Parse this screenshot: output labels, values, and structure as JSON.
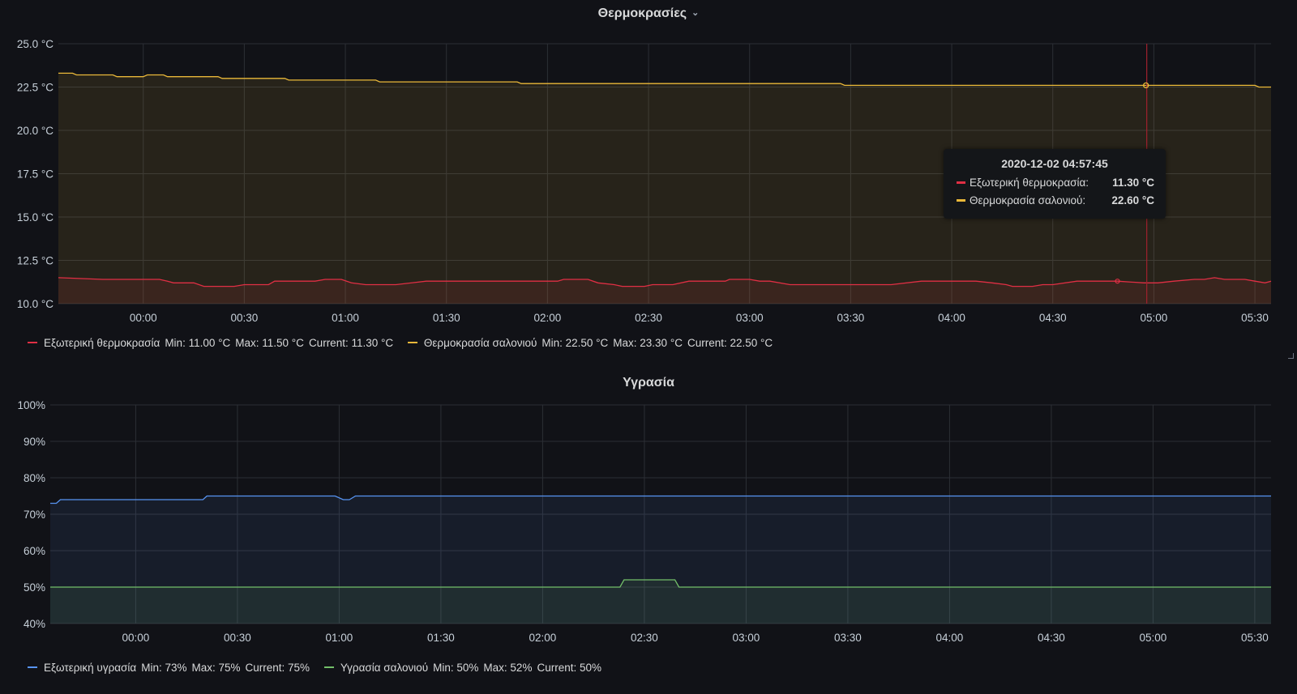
{
  "panels": [
    {
      "title": "Θερμοκρασίες",
      "chevron": "⌄",
      "x_ticks": [
        "00:00",
        "00:30",
        "01:00",
        "01:30",
        "02:00",
        "02:30",
        "03:00",
        "03:30",
        "04:00",
        "04:30",
        "05:00",
        "05:30"
      ],
      "y_ticks": [
        "25.0 °C",
        "22.5 °C",
        "20.0 °C",
        "17.5 °C",
        "15.0 °C",
        "12.5 °C",
        "10.0 °C"
      ],
      "legend": [
        {
          "name": "Εξωτερική θερμοκρασία",
          "min": "Min: 11.00 °C",
          "max": "Max: 11.50 °C",
          "current": "Current: 11.30 °C",
          "color": "#e02f44"
        },
        {
          "name": "Θερμοκρασία σαλονιού",
          "min": "Min: 22.50 °C",
          "max": "Max: 23.30 °C",
          "current": "Current: 22.50 °C",
          "color": "#eab839"
        }
      ],
      "tooltip": {
        "time": "2020-12-02 04:57:45",
        "rows": [
          {
            "label": "Εξωτερική θερμοκρασία:",
            "value": "11.30 °C",
            "color": "#e02f44"
          },
          {
            "label": "Θερμοκρασία σαλονιού:",
            "value": "22.60 °C",
            "color": "#eab839"
          }
        ]
      }
    },
    {
      "title": "Υγρασία",
      "x_ticks": [
        "00:00",
        "00:30",
        "01:00",
        "01:30",
        "02:00",
        "02:30",
        "03:00",
        "03:30",
        "04:00",
        "04:30",
        "05:00",
        "05:30"
      ],
      "y_ticks": [
        "100%",
        "90%",
        "80%",
        "70%",
        "60%",
        "50%",
        "40%"
      ],
      "legend": [
        {
          "name": "Εξωτερική υγρασία",
          "min": "Min: 73%",
          "max": "Max: 75%",
          "current": "Current: 75%",
          "color": "#5794f2"
        },
        {
          "name": "Υγρασία σαλονιού",
          "min": "Min: 50%",
          "max": "Max: 52%",
          "current": "Current: 50%",
          "color": "#73bf69"
        }
      ]
    }
  ],
  "chart_data": [
    {
      "type": "area",
      "title": "Θερμοκρασίες",
      "ylim": [
        10,
        25
      ],
      "x_unit": "hours after 00:00",
      "xlim": [
        -0.42,
        5.58
      ],
      "series": [
        {
          "name": "Εξωτερική θερμοκρασία",
          "color": "#e02f44",
          "points": [
            [
              -0.42,
              11.5
            ],
            [
              -0.2,
              11.4
            ],
            [
              0.08,
              11.4
            ],
            [
              0.12,
              11.3
            ],
            [
              0.15,
              11.2
            ],
            [
              0.25,
              11.2
            ],
            [
              0.3,
              11.0
            ],
            [
              0.45,
              11.0
            ],
            [
              0.5,
              11.1
            ],
            [
              0.62,
              11.1
            ],
            [
              0.65,
              11.3
            ],
            [
              0.85,
              11.3
            ],
            [
              0.9,
              11.4
            ],
            [
              0.98,
              11.4
            ],
            [
              1.03,
              11.2
            ],
            [
              1.1,
              11.1
            ],
            [
              1.25,
              11.1
            ],
            [
              1.4,
              11.3
            ],
            [
              2.05,
              11.3
            ],
            [
              2.08,
              11.4
            ],
            [
              2.2,
              11.4
            ],
            [
              2.25,
              11.2
            ],
            [
              2.33,
              11.1
            ],
            [
              2.37,
              11.0
            ],
            [
              2.48,
              11.0
            ],
            [
              2.52,
              11.1
            ],
            [
              2.62,
              11.1
            ],
            [
              2.7,
              11.3
            ],
            [
              2.88,
              11.3
            ],
            [
              2.9,
              11.4
            ],
            [
              3.0,
              11.4
            ],
            [
              3.05,
              11.3
            ],
            [
              3.1,
              11.3
            ],
            [
              3.2,
              11.1
            ],
            [
              3.7,
              11.1
            ],
            [
              3.85,
              11.3
            ],
            [
              4.12,
              11.3
            ],
            [
              4.2,
              11.2
            ],
            [
              4.27,
              11.1
            ],
            [
              4.3,
              11.0
            ],
            [
              4.4,
              11.0
            ],
            [
              4.45,
              11.1
            ],
            [
              4.5,
              11.1
            ],
            [
              4.62,
              11.3
            ],
            [
              4.82,
              11.3
            ],
            [
              4.95,
              11.2
            ],
            [
              5.02,
              11.2
            ],
            [
              5.1,
              11.3
            ],
            [
              5.2,
              11.4
            ],
            [
              5.25,
              11.4
            ],
            [
              5.3,
              11.5
            ],
            [
              5.35,
              11.4
            ],
            [
              5.45,
              11.4
            ],
            [
              5.5,
              11.3
            ],
            [
              5.55,
              11.2
            ],
            [
              5.58,
              11.3
            ]
          ]
        },
        {
          "name": "Θερμοκρασία σαλονιού",
          "color": "#eab839",
          "points": [
            [
              -0.42,
              23.3
            ],
            [
              -0.35,
              23.3
            ],
            [
              -0.33,
              23.2
            ],
            [
              -0.15,
              23.2
            ],
            [
              -0.13,
              23.1
            ],
            [
              0.0,
              23.1
            ],
            [
              0.02,
              23.2
            ],
            [
              0.1,
              23.2
            ],
            [
              0.12,
              23.1
            ],
            [
              0.37,
              23.1
            ],
            [
              0.39,
              23.0
            ],
            [
              0.7,
              23.0
            ],
            [
              0.72,
              22.9
            ],
            [
              1.15,
              22.9
            ],
            [
              1.17,
              22.8
            ],
            [
              1.85,
              22.8
            ],
            [
              1.87,
              22.7
            ],
            [
              3.45,
              22.7
            ],
            [
              3.47,
              22.6
            ],
            [
              5.5,
              22.6
            ],
            [
              5.52,
              22.5
            ],
            [
              5.58,
              22.5
            ]
          ]
        }
      ]
    },
    {
      "type": "area",
      "title": "Υγρασία",
      "ylim": [
        40,
        100
      ],
      "x_unit": "hours after 00:00",
      "xlim": [
        -0.42,
        5.58
      ],
      "series": [
        {
          "name": "Εξωτερική υγρασία",
          "color": "#5794f2",
          "points": [
            [
              -0.42,
              73
            ],
            [
              -0.39,
              73
            ],
            [
              -0.37,
              74
            ],
            [
              0.33,
              74
            ],
            [
              0.35,
              75
            ],
            [
              0.98,
              75
            ],
            [
              1.02,
              74
            ],
            [
              1.05,
              74
            ],
            [
              1.08,
              75
            ],
            [
              5.58,
              75
            ]
          ]
        },
        {
          "name": "Υγρασία σαλονιού",
          "color": "#73bf69",
          "points": [
            [
              -0.42,
              50
            ],
            [
              2.38,
              50
            ],
            [
              2.4,
              52
            ],
            [
              2.65,
              52
            ],
            [
              2.67,
              50
            ],
            [
              5.58,
              50
            ]
          ]
        }
      ]
    }
  ]
}
